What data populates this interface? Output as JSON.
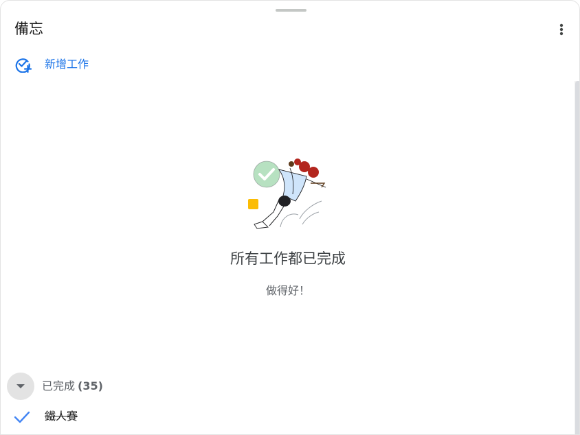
{
  "header": {
    "title": "備忘",
    "more_icon": "more-vert-icon"
  },
  "add_task": {
    "icon": "add-task-icon",
    "label": "新增工作"
  },
  "empty_state": {
    "illustration": "tasks-complete-illustration",
    "title": "所有工作都已完成",
    "subtitle": "做得好！"
  },
  "completed_section": {
    "label": "已完成",
    "count": "(35)",
    "toggle_icon": "arrow-drop-down-icon"
  },
  "completed_tasks": [
    {
      "label": "鐵人賽",
      "icon": "check-icon"
    }
  ],
  "colors": {
    "accent": "#1a73e8",
    "check": "#4285f4",
    "text_primary": "#1f1f1f",
    "text_secondary": "#5f6368"
  }
}
